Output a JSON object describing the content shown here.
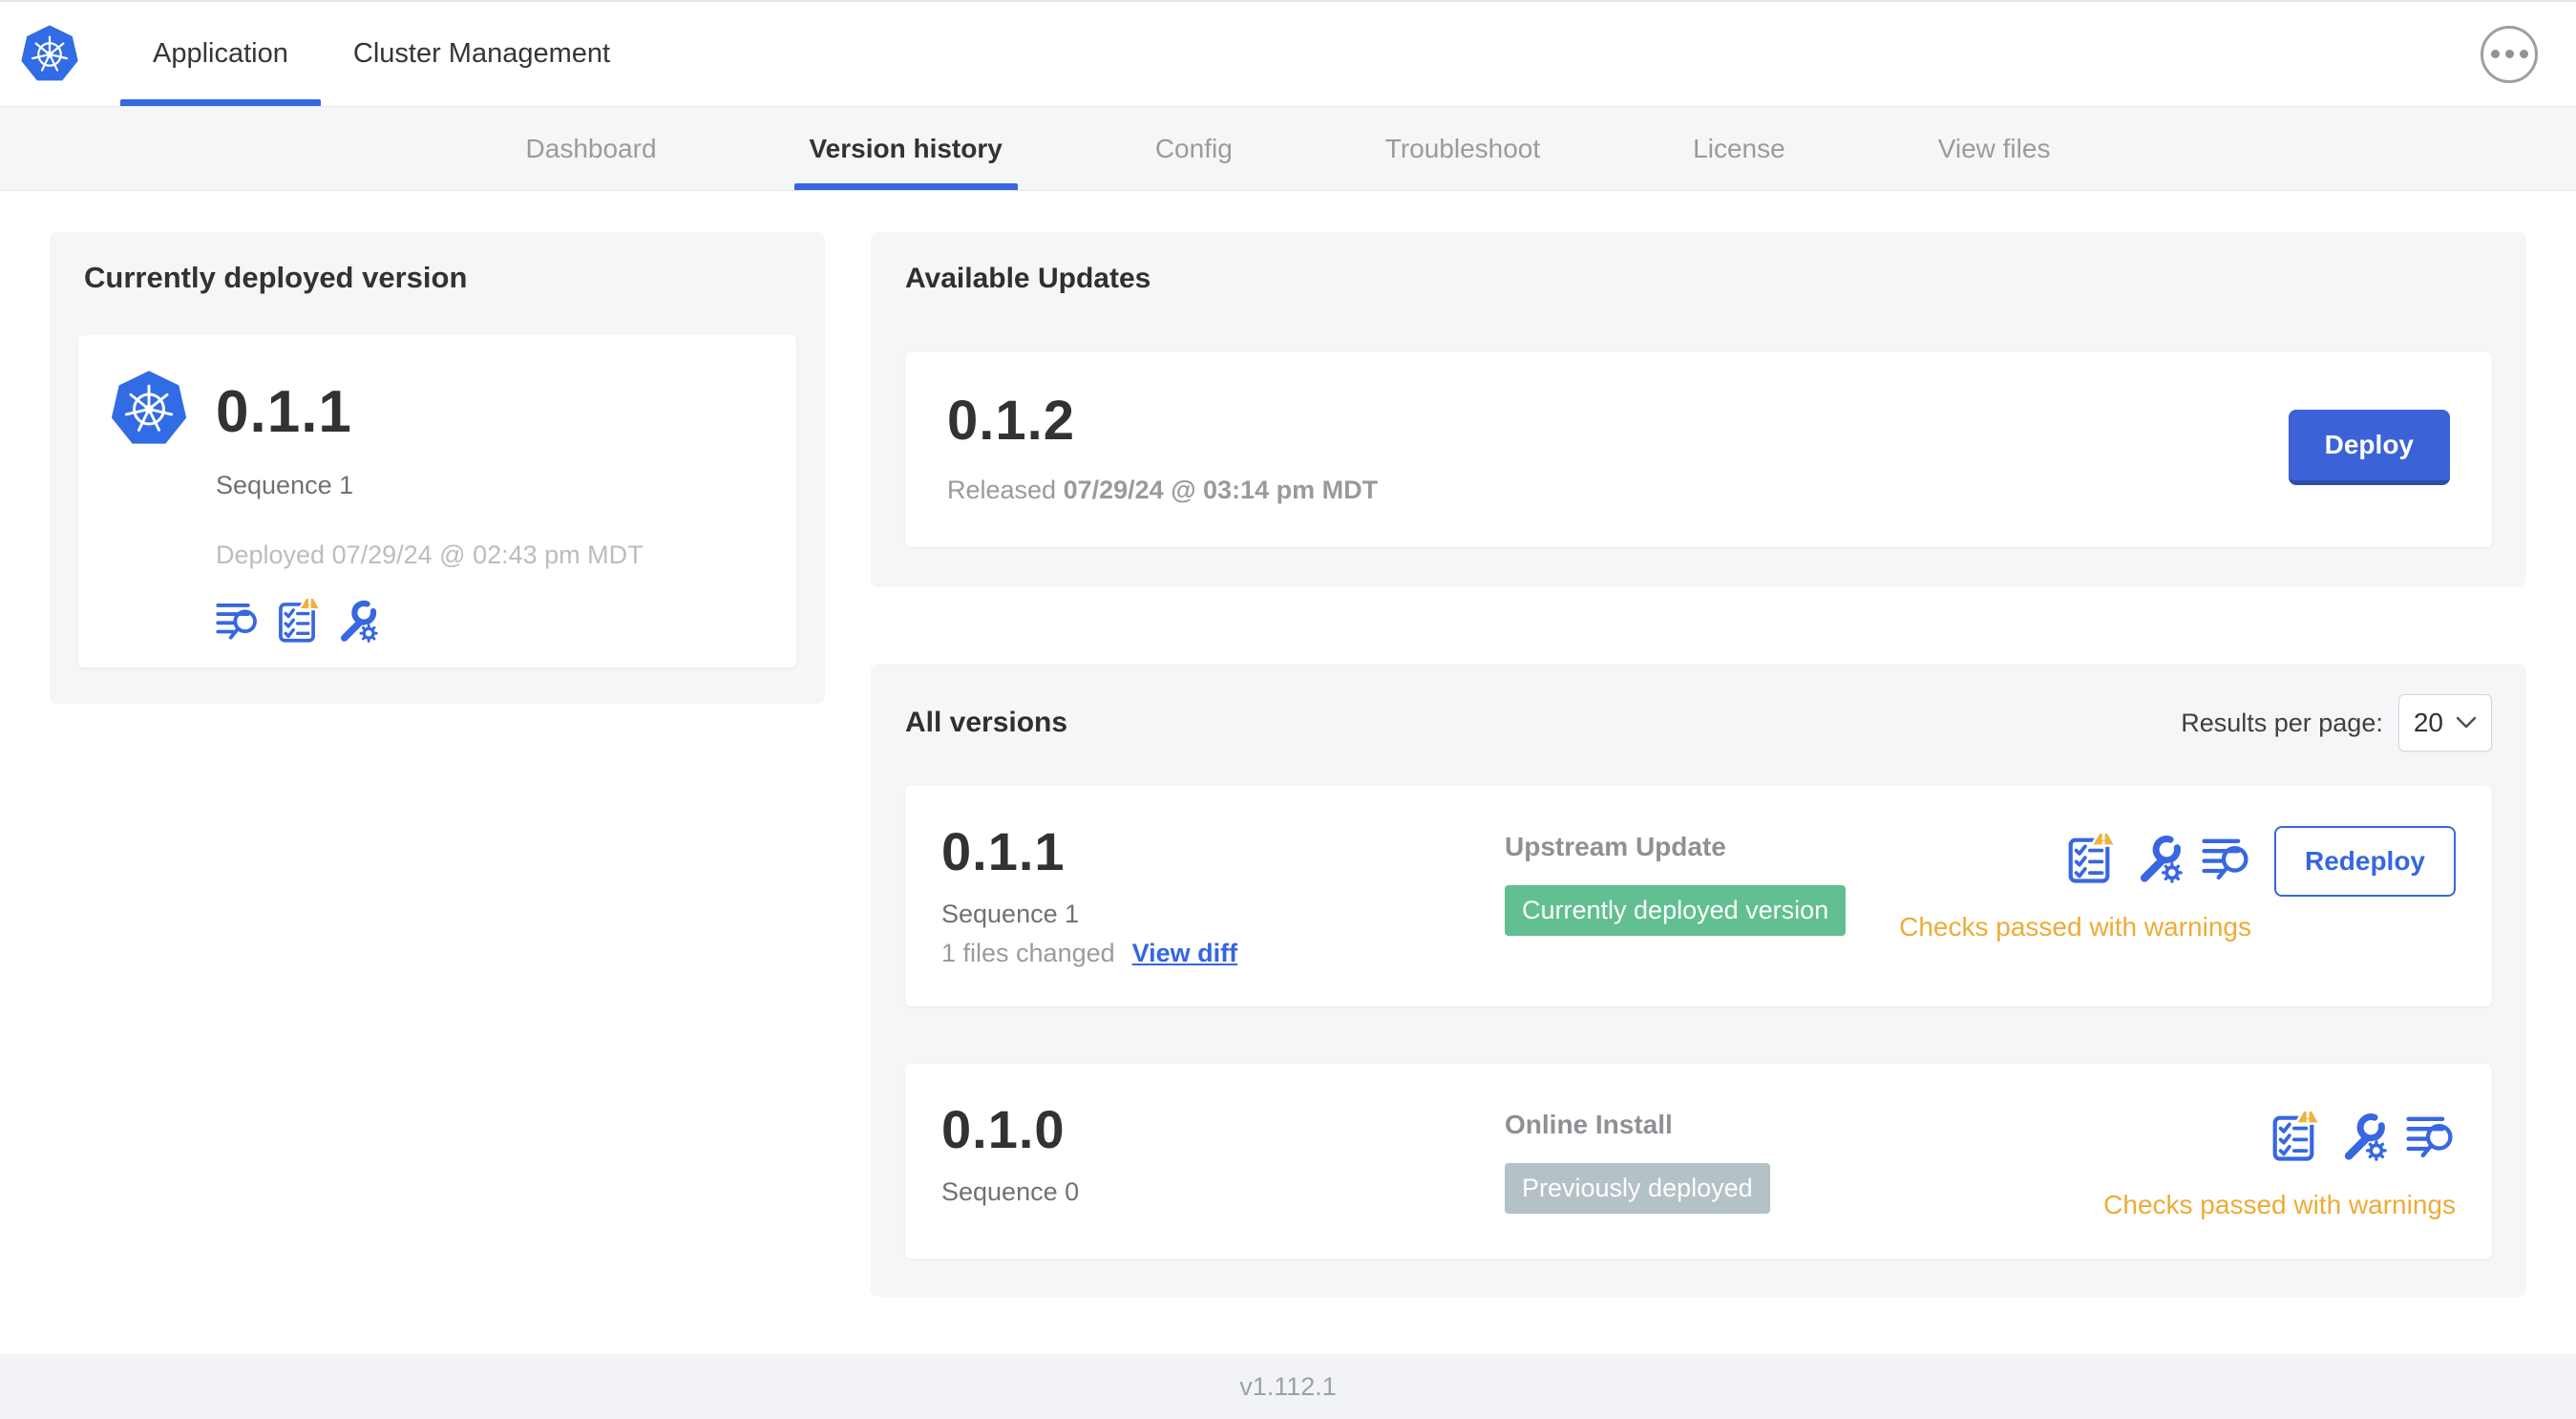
{
  "header": {
    "brand_icon": "kubernetes-logo",
    "tabs": [
      {
        "label": "Application",
        "active": true
      },
      {
        "label": "Cluster Management",
        "active": false
      }
    ],
    "menu_icon": "ellipsis-menu"
  },
  "subnav": {
    "tabs": [
      {
        "label": "Dashboard",
        "active": false
      },
      {
        "label": "Version history",
        "active": true
      },
      {
        "label": "Config",
        "active": false
      },
      {
        "label": "Troubleshoot",
        "active": false
      },
      {
        "label": "License",
        "active": false
      },
      {
        "label": "View files",
        "active": false
      }
    ]
  },
  "deployed_card": {
    "title": "Currently deployed version",
    "app_icon": "kubernetes-logo",
    "version": "0.1.1",
    "sequence": "Sequence 1",
    "deployed_text": "Deployed 07/29/24 @ 02:43 pm MDT",
    "icons": [
      "diff-view-icon",
      "preflight-checks-warning-icon",
      "config-edit-icon"
    ]
  },
  "available_updates": {
    "title": "Available Updates",
    "update": {
      "version": "0.1.2",
      "released_prefix": "Released",
      "released_date": "07/29/24 @ 03:14 pm MDT",
      "deploy_button": "Deploy"
    }
  },
  "all_versions": {
    "title": "All versions",
    "results_per_page_label": "Results per page:",
    "results_per_page": "20",
    "rows": [
      {
        "version": "0.1.1",
        "sequence": "Sequence 1",
        "files_changed": "1 files changed",
        "view_diff_link": "View diff",
        "source_type": "Upstream Update",
        "badge_label": "Currently deployed version",
        "badge_color": "#61bf91",
        "icons": [
          "preflight-checks-warning-icon",
          "config-edit-icon",
          "diff-view-icon"
        ],
        "status_text": "Checks passed with warnings",
        "action_button": "Redeploy"
      },
      {
        "version": "0.1.0",
        "sequence": "Sequence 0",
        "source_type": "Online Install",
        "badge_label": "Previously deployed",
        "badge_color": "#b4c1c6",
        "icons": [
          "preflight-checks-warning-icon",
          "config-edit-icon",
          "diff-view-icon"
        ],
        "status_text": "Checks passed with warnings"
      }
    ]
  },
  "footer": {
    "app_version": "v1.112.1"
  },
  "colors": {
    "accent_blue": "#3666e0",
    "kubernetes_blue": "#326ce5",
    "button_blue": "#3b62d6",
    "warning_amber": "#eeab35",
    "badge_green": "#61bf91",
    "badge_gray": "#b4c1c6",
    "card_gray": "#f5f6f8"
  }
}
